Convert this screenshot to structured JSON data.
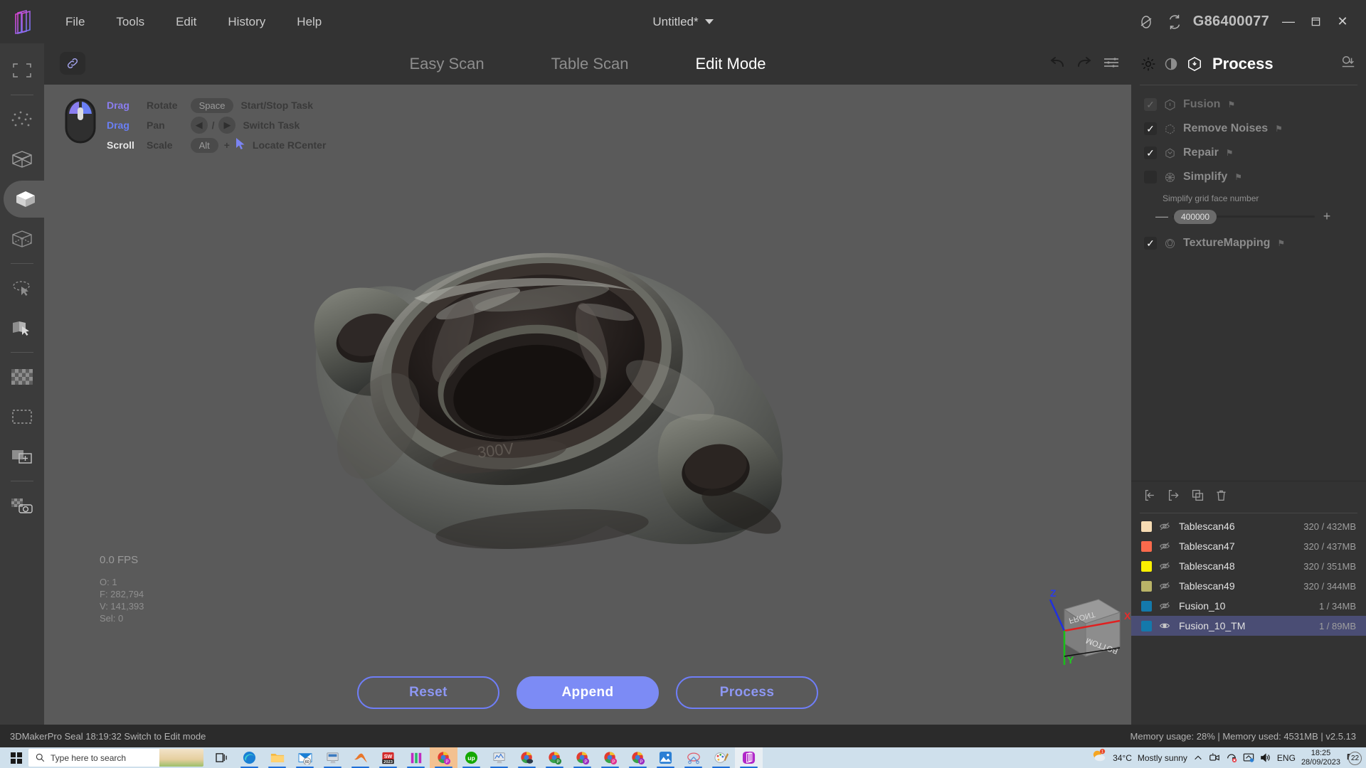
{
  "titlebar": {
    "menu": [
      "File",
      "Tools",
      "Edit",
      "History",
      "Help"
    ],
    "doc_title": "Untitled*",
    "serial": "G86400077",
    "icons": [
      "no-connection-icon",
      "refresh-icon"
    ],
    "window_buttons": {
      "minimize": "—",
      "maximize": "❐",
      "close": "✕"
    }
  },
  "rail": {
    "items": [
      {
        "name": "fit-view-icon",
        "label": "Fit View"
      },
      {
        "name": "point-cloud-icon",
        "label": "Point Cloud"
      },
      {
        "name": "wireframe-mesh-icon",
        "label": "Wireframe"
      },
      {
        "name": "solid-mesh-icon",
        "label": "Solid Mesh"
      },
      {
        "name": "transparent-mesh-icon",
        "label": "Transparent Mesh"
      },
      {
        "name": "lasso-select-icon",
        "label": "Lasso Select"
      },
      {
        "name": "plane-select-icon",
        "label": "Plane Select"
      },
      {
        "name": "checker-texture-icon",
        "label": "Texture"
      },
      {
        "name": "rect-select-icon",
        "label": "Rectangle Select"
      },
      {
        "name": "add-layer-icon",
        "label": "Add Layer"
      },
      {
        "name": "texture-capture-icon",
        "label": "Texture Capture"
      }
    ],
    "active_index": 3
  },
  "tabs": {
    "items": [
      "Easy Scan",
      "Table Scan",
      "Edit Mode"
    ],
    "active": "Edit Mode"
  },
  "viewport": {
    "legend": {
      "mouse_rows": [
        {
          "key": "Drag",
          "action": "Rotate"
        },
        {
          "key": "Drag",
          "action": "Pan"
        },
        {
          "key": "Scroll",
          "action": "Scale"
        }
      ],
      "key_rows": [
        {
          "key": "Space",
          "action": "Start/Stop Task"
        },
        {
          "key": "←/→",
          "action": "Switch Task"
        },
        {
          "key": "Alt + ▶",
          "action": "Locate RCenter"
        }
      ]
    },
    "stats": {
      "fps": "0.0 FPS",
      "objects": "O: 1",
      "faces": "F: 282,794",
      "vertices": "V: 141,393",
      "selected": "Sel: 0"
    },
    "gizmo": {
      "face_front": "FRONT",
      "face_bottom": "BOTTOM",
      "axis_x": "X",
      "axis_y": "Y",
      "axis_z": "Z"
    },
    "actions": {
      "reset": "Reset",
      "append": "Append",
      "process": "Process"
    }
  },
  "right_panel": {
    "title": "Process",
    "header_icons": [
      "brightness-icon",
      "contrast-icon",
      "cube-process-icon",
      "export-view-icon"
    ],
    "steps": [
      {
        "label": "Fusion",
        "checked": true,
        "enabled": false,
        "icon": "fusion-icon"
      },
      {
        "label": "Remove Noises",
        "checked": true,
        "enabled": true,
        "icon": "denoise-icon"
      },
      {
        "label": "Repair",
        "checked": true,
        "enabled": true,
        "icon": "repair-icon"
      },
      {
        "label": "Simplify",
        "checked": false,
        "enabled": true,
        "icon": "simplify-icon"
      },
      {
        "label": "TextureMapping",
        "checked": true,
        "enabled": true,
        "icon": "texture-icon"
      }
    ],
    "slider": {
      "caption": "Simplify grid face number",
      "value": "400000",
      "minus": "—",
      "plus": "+"
    }
  },
  "file_list": {
    "toolbar": [
      "import-icon",
      "export-icon",
      "duplicate-icon",
      "delete-icon"
    ],
    "rows": [
      {
        "name": "Tablescan46",
        "size": "320 / 432MB",
        "color": "#f7dcb4",
        "visible": false
      },
      {
        "name": "Tablescan47",
        "size": "320 / 437MB",
        "color": "#fa6a4c",
        "visible": false
      },
      {
        "name": "Tablescan48",
        "size": "320 / 351MB",
        "color": "#faf000",
        "visible": false
      },
      {
        "name": "Tablescan49",
        "size": "320 / 344MB",
        "color": "#b9b368",
        "visible": false
      },
      {
        "name": "Fusion_10",
        "size": "1 / 34MB",
        "color": "#1479ab",
        "visible": false
      },
      {
        "name": "Fusion_10_TM",
        "size": "1 / 89MB",
        "color": "#1479ab",
        "visible": true,
        "selected": true
      }
    ]
  },
  "status_bar": {
    "left": "3DMakerPro Seal   18:19:32 Switch to Edit mode",
    "right": "Memory usage: 28% | Memory used: 4531MB | v2.5.13"
  },
  "taskbar": {
    "search_placeholder": "Type here to search",
    "apps": [
      {
        "name": "task-view-icon",
        "running": false
      },
      {
        "name": "edge-icon",
        "running": true
      },
      {
        "name": "file-explorer-icon",
        "running": true
      },
      {
        "name": "mail-icon",
        "running": true,
        "badge": "60"
      },
      {
        "name": "remote-desktop-icon",
        "running": true
      },
      {
        "name": "matlab-icon",
        "running": true
      },
      {
        "name": "solidworks-2023-icon",
        "running": true
      },
      {
        "name": "nvidia-icon",
        "running": true
      },
      {
        "name": "chrome-profile-p-icon",
        "running": true,
        "active": true
      },
      {
        "name": "upwork-icon",
        "running": true
      },
      {
        "name": "system-monitor-icon",
        "running": true
      },
      {
        "name": "chrome-icon",
        "running": true
      },
      {
        "name": "chrome-profile-green-icon",
        "running": true
      },
      {
        "name": "chrome-profile-purple-icon",
        "running": true
      },
      {
        "name": "chrome-profile-pink-icon",
        "running": true
      },
      {
        "name": "chrome-profile-purple2-icon",
        "running": true
      },
      {
        "name": "photos-icon",
        "running": true
      },
      {
        "name": "snip-sketch-icon",
        "running": true
      },
      {
        "name": "paint-icon",
        "running": true
      },
      {
        "name": "3dmakerpro-icon",
        "running": true,
        "active": true
      }
    ],
    "weather": {
      "temp": "34°C",
      "desc": "Mostly sunny"
    },
    "tray_icons": [
      "chevron-up-icon",
      "camera-icon",
      "no-audio-device-icon",
      "display-icon",
      "volume-icon"
    ],
    "language": "ENG",
    "clock_time": "18:25",
    "clock_date": "28/09/2023",
    "notification_count": "22"
  },
  "colors": {
    "accent": "#7c8bf5",
    "panel_bg": "#333333",
    "viewport_bg": "#5a5a5a",
    "selected_row": "#4a4d74"
  }
}
